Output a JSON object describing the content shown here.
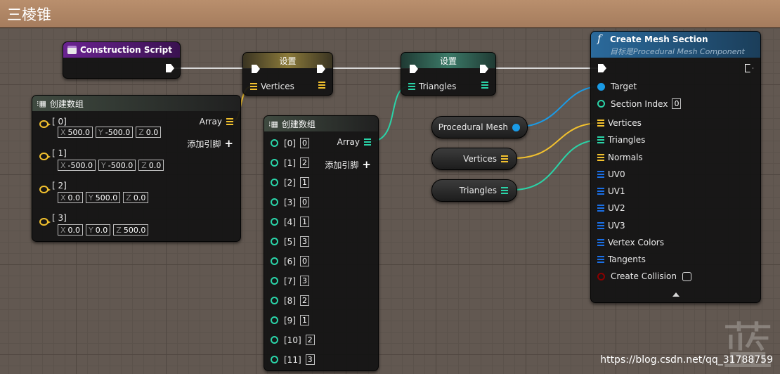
{
  "title": "三棱锥",
  "colors": {
    "exec": "#ffffff",
    "vector_pin": "#f2c12e",
    "int_pin": "#2ad4a8",
    "object_pin": "#1a9be6",
    "bool_pin": "#8b0000",
    "construction_header": "#5b1c78",
    "set_header": "#7a6a34",
    "set_header_tri": "#2f6a5c",
    "function_header": "#1f4f7a"
  },
  "construction_script": {
    "label": "Construction Script",
    "icon": "construction-icon"
  },
  "set_vertices": {
    "title": "设置",
    "pin_label": "Vertices"
  },
  "set_triangles": {
    "title": "设置",
    "pin_label": "Triangles"
  },
  "make_array_vec": {
    "title": "创建数组",
    "output_label": "Array",
    "add_pin_label": "添加引脚",
    "items": [
      {
        "index": "[ 0]",
        "x": "500.0",
        "y": "-500.0",
        "z": "0.0"
      },
      {
        "index": "[ 1]",
        "x": "-500.0",
        "y": "-500.0",
        "z": "0.0"
      },
      {
        "index": "[ 2]",
        "x": "0.0",
        "y": "500.0",
        "z": "0.0"
      },
      {
        "index": "[ 3]",
        "x": "0.0",
        "y": "0.0",
        "z": "500.0"
      }
    ]
  },
  "make_array_int": {
    "title": "创建数组",
    "output_label": "Array",
    "add_pin_label": "添加引脚",
    "items": [
      {
        "index": "[0]",
        "value": "0"
      },
      {
        "index": "[1]",
        "value": "2"
      },
      {
        "index": "[2]",
        "value": "1"
      },
      {
        "index": "[3]",
        "value": "0"
      },
      {
        "index": "[4]",
        "value": "1"
      },
      {
        "index": "[5]",
        "value": "3"
      },
      {
        "index": "[6]",
        "value": "0"
      },
      {
        "index": "[7]",
        "value": "3"
      },
      {
        "index": "[8]",
        "value": "2"
      },
      {
        "index": "[9]",
        "value": "1"
      },
      {
        "index": "[10]",
        "value": "2"
      },
      {
        "index": "[11]",
        "value": "3"
      }
    ]
  },
  "var_procedural_mesh": {
    "label": "Procedural Mesh"
  },
  "var_vertices": {
    "label": "Vertices"
  },
  "var_triangles": {
    "label": "Triangles"
  },
  "create_mesh_section": {
    "title": "Create Mesh Section",
    "subtitle": "目标是Procedural Mesh Component",
    "pins": {
      "target": "Target",
      "section_index": "Section Index",
      "section_index_value": "0",
      "vertices": "Vertices",
      "triangles": "Triangles",
      "normals": "Normals",
      "uv0": "UV0",
      "uv1": "UV1",
      "uv2": "UV2",
      "uv3": "UV3",
      "vertex_colors": "Vertex Colors",
      "tangents": "Tangents",
      "create_collision": "Create Collision"
    }
  },
  "watermark": "https://blog.csdn.net/qq_31788759",
  "corner_glyph": "蓝"
}
